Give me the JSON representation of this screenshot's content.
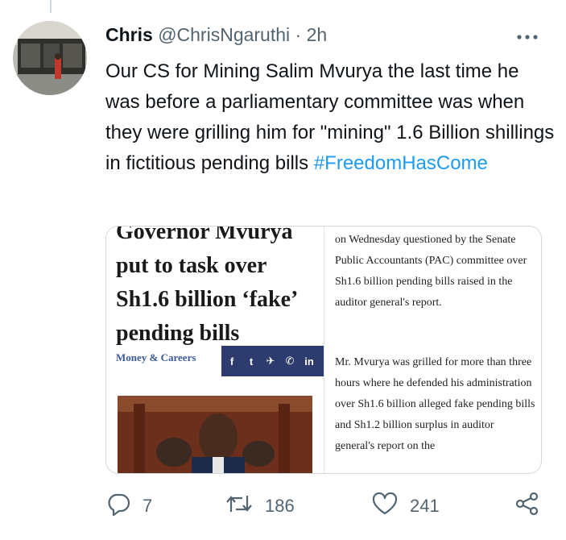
{
  "tweet": {
    "author_name": "Chris",
    "author_handle": "@ChrisNgaruthi",
    "separator": "·",
    "time": "2h",
    "text_main": "Our CS for Mining Salim Mvurya the last time he was before a parliamentary committee was when they were grilling him for \"mining\" 1.6 Billion shillings in fictitious pending bills ",
    "hashtag": "#FreedomHasCome"
  },
  "clipping": {
    "headline_lines": [
      "Governor Mvurya",
      "put to task over",
      "Sh1.6 billion ‘fake’",
      "pending bills"
    ],
    "section": "Money & Careers",
    "share_icons": [
      "f",
      "t",
      "✈",
      "✆",
      "in"
    ],
    "body_para1": "on Wednesday questioned by the Senate Public Accountants (PAC) committee over Sh1.6 billion pending bills raised in the auditor general's report.",
    "body_para2": "Mr. Mvurya was grilled for more than three hours where he defended his administration over Sh1.6 billion alleged fake pending bills and Sh1.2 billion surplus in auditor general's report on the"
  },
  "actions": {
    "reply_count": "7",
    "retweet_count": "186",
    "like_count": "241"
  },
  "colors": {
    "accent": "#1d9bf0",
    "secondary_text": "#536471",
    "share_bar": "#2e3b6e"
  },
  "icons": [
    "more-icon",
    "reply-icon",
    "retweet-icon",
    "like-icon",
    "share-icon"
  ]
}
